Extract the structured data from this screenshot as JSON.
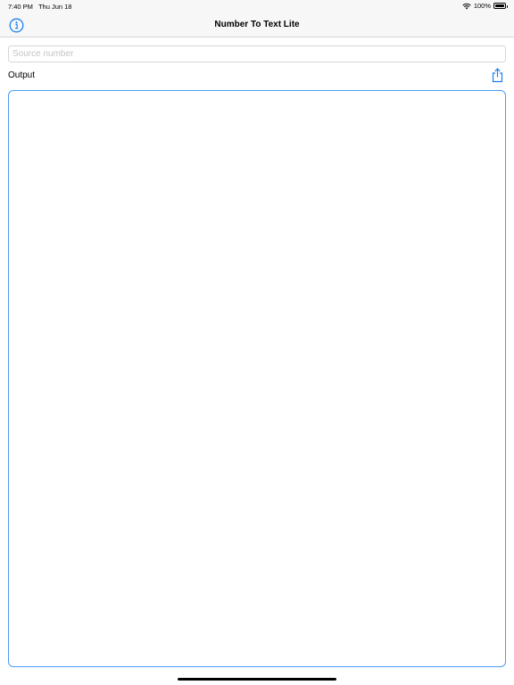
{
  "status_bar": {
    "time": "7:40 PM",
    "date": "Thu Jun 18",
    "battery_percent": "100%",
    "battery_level": 1.0,
    "wifi_icon": "wifi-icon",
    "battery_icon": "battery-icon"
  },
  "nav": {
    "title": "Number To Text Lite",
    "info_icon": "info-circle-icon"
  },
  "source": {
    "value": "",
    "placeholder": "Source number"
  },
  "output": {
    "label": "Output",
    "share_icon": "share-icon",
    "value": ""
  },
  "colors": {
    "accent": "#1a7ff0",
    "output_border": "#4a9ff5",
    "bar_background": "#f7f7f7",
    "placeholder": "#c4c4c6"
  }
}
